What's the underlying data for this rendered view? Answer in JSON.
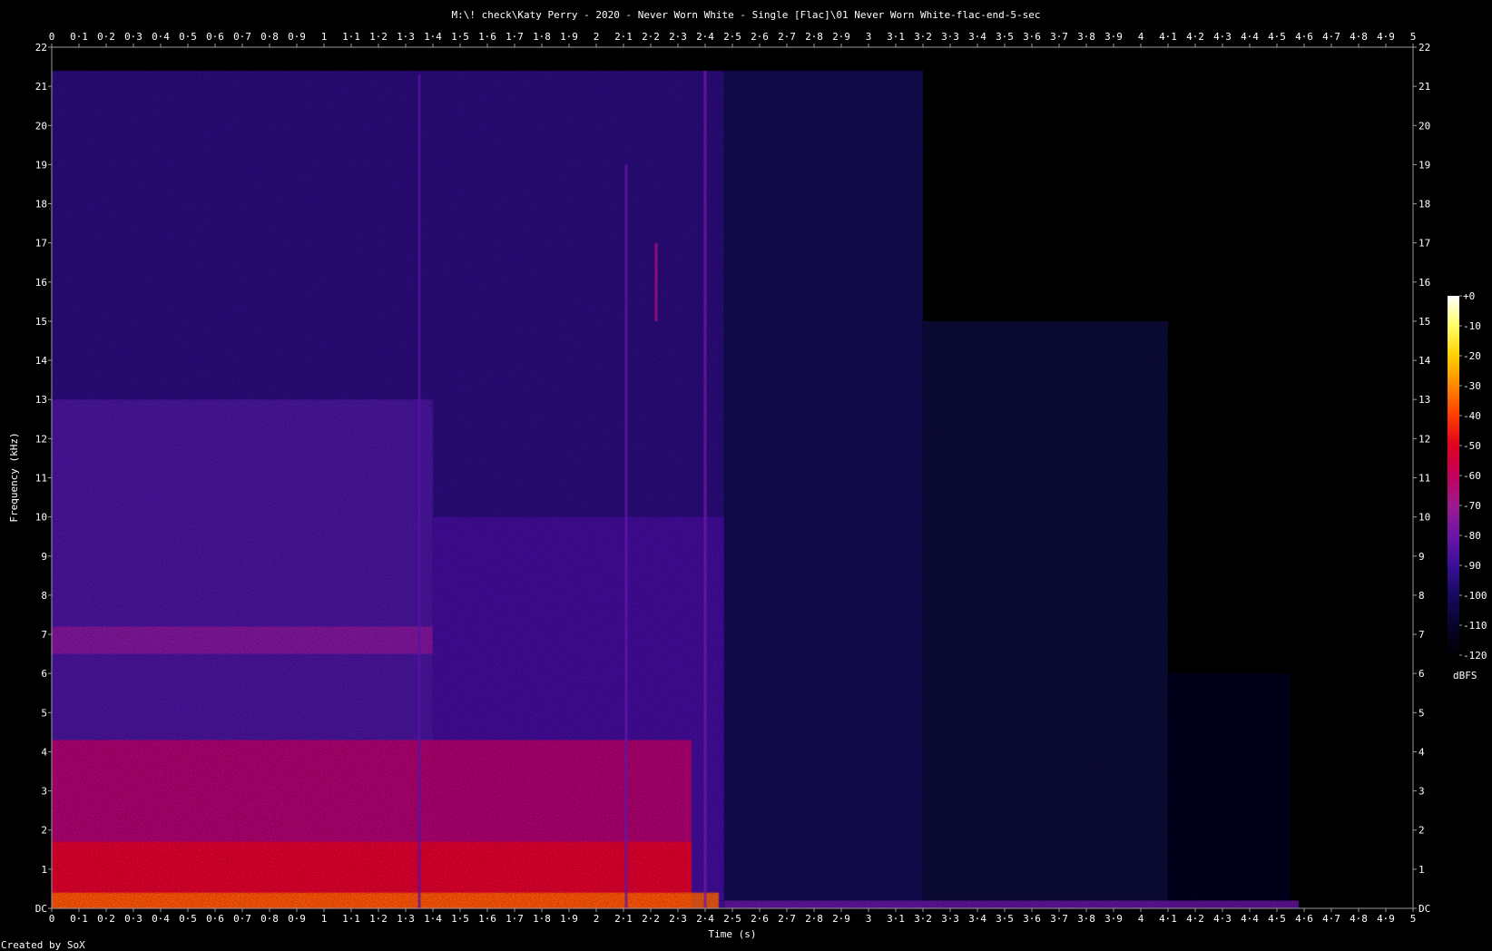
{
  "chart_data": {
    "type": "heatmap",
    "title": "M:\\! check\\Katy Perry - 2020 - Never Worn White - Single [Flac]\\01 Never Worn White-flac-end-5-sec",
    "xlabel": "Time (s)",
    "ylabel": "Frequency (kHz)",
    "xlim": [
      0,
      5
    ],
    "ylim": [
      0,
      22
    ],
    "x_ticks": [
      "0",
      "0·1",
      "0·2",
      "0·3",
      "0·4",
      "0·5",
      "0·6",
      "0·7",
      "0·8",
      "0·9",
      "1",
      "1·1",
      "1·2",
      "1·3",
      "1·4",
      "1·5",
      "1·6",
      "1·7",
      "1·8",
      "1·9",
      "2",
      "2·1",
      "2·2",
      "2·3",
      "2·4",
      "2·5",
      "2·6",
      "2·7",
      "2·8",
      "2·9",
      "3",
      "3·1",
      "3·2",
      "3·3",
      "3·4",
      "3·5",
      "3·6",
      "3·7",
      "3·8",
      "3·9",
      "4",
      "4·1",
      "4·2",
      "4·3",
      "4·4",
      "4·5",
      "4·6",
      "4·7",
      "4·8",
      "4·9",
      "5"
    ],
    "y_ticks": [
      "DC",
      "1",
      "2",
      "3",
      "4",
      "5",
      "6",
      "7",
      "8",
      "9",
      "10",
      "11",
      "12",
      "13",
      "14",
      "15",
      "16",
      "17",
      "18",
      "19",
      "20",
      "21",
      "22"
    ],
    "colorbar": {
      "label": "dBFS",
      "range": [
        -120,
        0
      ],
      "ticks": [
        "+0",
        "-10",
        "-20",
        "-30",
        "-40",
        "-50",
        "-60",
        "-70",
        "-80",
        "-90",
        "-100",
        "-110",
        "-120"
      ],
      "colors": [
        "#ffffff",
        "#ffff66",
        "#ffd000",
        "#ff8800",
        "#ff3c00",
        "#e30020",
        "#c3005c",
        "#9d1a8e",
        "#6a16a6",
        "#3a0f9a",
        "#150a5e",
        "#06052a",
        "#000000"
      ]
    },
    "regions": [
      {
        "t": [
          0,
          2.47
        ],
        "f": [
          0,
          21.4
        ],
        "level": -92
      },
      {
        "t": [
          0,
          1.4
        ],
        "f": [
          0,
          13.0
        ],
        "level": -86
      },
      {
        "t": [
          0,
          1.4
        ],
        "f": [
          6.5,
          7.2
        ],
        "level": -74
      },
      {
        "t": [
          1.4,
          2.47
        ],
        "f": [
          0,
          10.0
        ],
        "level": -88
      },
      {
        "t": [
          0,
          2.35
        ],
        "f": [
          0,
          4.3
        ],
        "level": -62
      },
      {
        "t": [
          0,
          2.35
        ],
        "f": [
          0,
          1.7
        ],
        "level": -50
      },
      {
        "t": [
          0,
          2.45
        ],
        "f": [
          0,
          0.4
        ],
        "level": -35
      },
      {
        "t": [
          2.47,
          3.2
        ],
        "f": [
          0,
          21.4
        ],
        "level": -100
      },
      {
        "t": [
          3.2,
          4.1
        ],
        "f": [
          0,
          15.0
        ],
        "level": -106
      },
      {
        "t": [
          4.1,
          4.55
        ],
        "f": [
          0,
          6.0
        ],
        "level": -112
      },
      {
        "t": [
          2.47,
          4.58
        ],
        "f": [
          0,
          0.2
        ],
        "level": -80
      }
    ],
    "streaks": [
      {
        "t": 1.35,
        "f": [
          0,
          21.3
        ],
        "level": -84
      },
      {
        "t": 2.11,
        "f": [
          0,
          19.0
        ],
        "level": -82
      },
      {
        "t": 2.4,
        "f": [
          0,
          21.4
        ],
        "level": -78
      },
      {
        "t": 2.22,
        "f": [
          15.0,
          17.0
        ],
        "level": -66
      }
    ]
  },
  "footer": {
    "credit": "Created by SoX"
  }
}
